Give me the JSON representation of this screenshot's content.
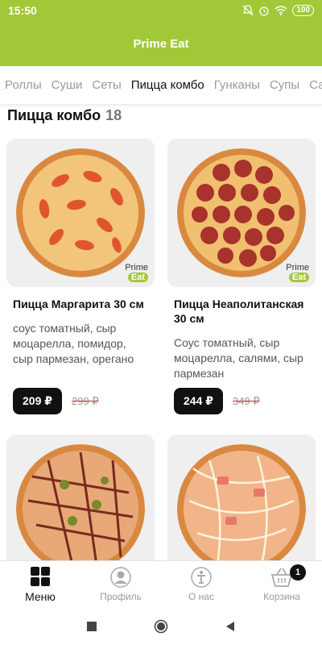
{
  "status_bar": {
    "time": "15:50",
    "battery": "100"
  },
  "app": {
    "title": "Prime Eat"
  },
  "tabs": [
    {
      "label": "Роллы",
      "active": false
    },
    {
      "label": "Суши",
      "active": false
    },
    {
      "label": "Сеты",
      "active": false
    },
    {
      "label": "Пицца комбо",
      "active": true
    },
    {
      "label": "Гунканы",
      "active": false
    },
    {
      "label": "Супы",
      "active": false
    },
    {
      "label": "Са",
      "active": false
    }
  ],
  "section": {
    "title": "Пицца комбо",
    "count": "18"
  },
  "products": [
    {
      "name": "Пицца Маргарита 30 см",
      "description": "соус томатный, сыр моцарелла, помидор, сыр пармезан, орегано",
      "price": "209 ₽",
      "old_price": "299 ₽",
      "logo_top": "Prime",
      "logo_bottom": "Eat"
    },
    {
      "name": "Пицца Неаполитанская 30 см",
      "description": "Соус томатный, сыр моцарелла, салями, сыр пармезан",
      "price": "244 ₽",
      "old_price": "349 ₽",
      "logo_top": "Prime",
      "logo_bottom": "Eat"
    }
  ],
  "bottom_nav": [
    {
      "label": "Меню",
      "icon": "grid-icon",
      "active": true
    },
    {
      "label": "Профиль",
      "icon": "profile-icon",
      "active": false
    },
    {
      "label": "О нас",
      "icon": "info-icon",
      "active": false
    },
    {
      "label": "Корзина",
      "icon": "basket-icon",
      "active": false
    }
  ],
  "cart_badge": "1",
  "colors": {
    "accent": "#a3c837",
    "price_bg": "#111111",
    "strike": "#dd2222"
  }
}
